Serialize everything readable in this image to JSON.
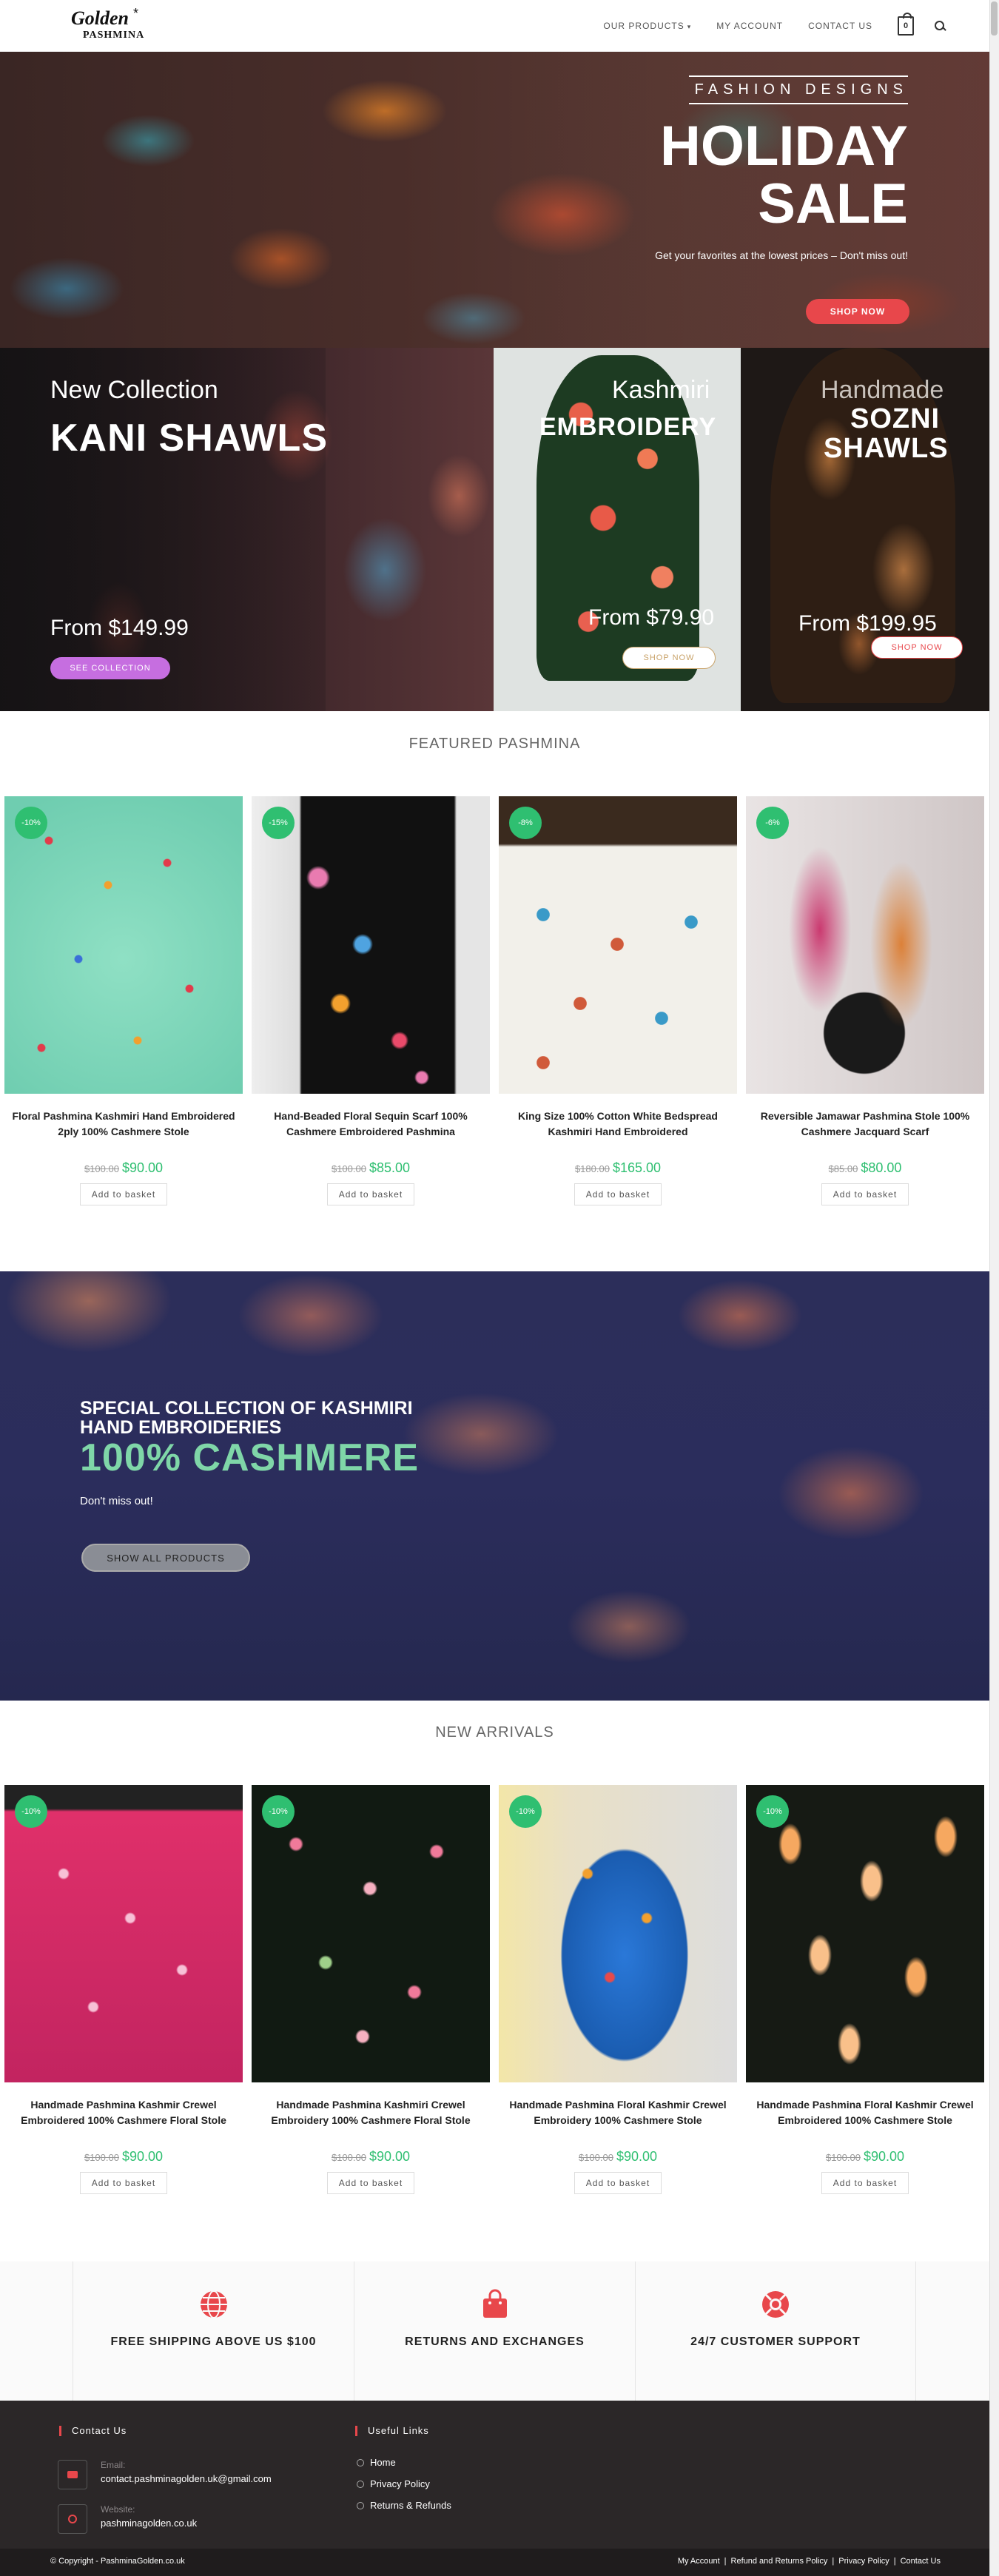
{
  "header": {
    "logo_top": "Golden",
    "logo_bottom": "PASHMINA",
    "nav": [
      "OUR PRODUCTS",
      "MY ACCOUNT",
      "CONTACT US"
    ],
    "cart_count": "0"
  },
  "hero": {
    "subtitle": "FASHION DESIGNS",
    "title_line1": "HOLIDAY",
    "title_line2": "SALE",
    "tagline": "Get your favorites at the lowest prices – Don't miss out!",
    "button": "SHOP NOW"
  },
  "promos": [
    {
      "line1": "New Collection",
      "line2": "KANI SHAWLS",
      "price": "From $149.99",
      "button": "SEE COLLECTION",
      "button_color": "#c66ee0"
    },
    {
      "line1": "Kashmiri",
      "line2": "EMBROIDERY",
      "price": "From $79.90",
      "button": "SHOP NOW"
    },
    {
      "line1": "Handmade",
      "line2": "SOZNI",
      "line3": "SHAWLS",
      "price": "From $199.95",
      "button": "SHOP NOW"
    }
  ],
  "featured": {
    "title": "FEATURED PASHMINA",
    "products": [
      {
        "badge": "-10%",
        "name": "Floral Pashmina Kashmiri Hand Embroidered 2ply 100% Cashmere Stole",
        "old_price": "$100.00",
        "price": "$90.00",
        "button": "Add to basket"
      },
      {
        "badge": "-15%",
        "name": "Hand-Beaded Floral Sequin Scarf 100% Cashmere Embroidered Pashmina",
        "old_price": "$100.00",
        "price": "$85.00",
        "button": "Add to basket"
      },
      {
        "badge": "-8%",
        "name": "King Size 100% Cotton White Bedspread Kashmiri Hand Embroidered",
        "old_price": "$180.00",
        "price": "$165.00",
        "button": "Add to basket"
      },
      {
        "badge": "-6%",
        "name": "Reversible Jamawar Pashmina Stole 100% Cashmere Jacquard Scarf",
        "old_price": "$85.00",
        "price": "$80.00",
        "button": "Add to basket"
      }
    ]
  },
  "banner": {
    "line1": "SPECIAL COLLECTION OF KASHMIRI HAND EMBROIDERIES",
    "line2": "100% CASHMERE",
    "line3": "Don't miss out!",
    "button": "SHOW ALL PRODUCTS"
  },
  "new_arrivals": {
    "title": "NEW ARRIVALS",
    "products": [
      {
        "badge": "-10%",
        "name": "Handmade Pashmina Kashmir Crewel Embroidered 100% Cashmere Floral Stole",
        "old_price": "$100.00",
        "price": "$90.00",
        "button": "Add to basket"
      },
      {
        "badge": "-10%",
        "name": "Handmade Pashmina Kashmiri Crewel Embroidery 100% Cashmere Floral Stole",
        "old_price": "$100.00",
        "price": "$90.00",
        "button": "Add to basket"
      },
      {
        "badge": "-10%",
        "name": "Handmade Pashmina Floral Kashmir Crewel Embroidery 100% Cashmere Stole",
        "old_price": "$100.00",
        "price": "$90.00",
        "button": "Add to basket"
      },
      {
        "badge": "-10%",
        "name": "Handmade Pashmina Floral Kashmir Crewel Embroidered 100% Cashmere Stole",
        "old_price": "$100.00",
        "price": "$90.00",
        "button": "Add to basket"
      }
    ]
  },
  "features": [
    {
      "icon": "globe-icon",
      "label": "FREE SHIPPING ABOVE US $100"
    },
    {
      "icon": "shopping-bag-icon",
      "label": "RETURNS AND EXCHANGES"
    },
    {
      "icon": "lifebuoy-icon",
      "label": "24/7 CUSTOMER SUPPORT"
    }
  ],
  "footer": {
    "contact_title": "Contact Us",
    "email_label": "Email:",
    "email": "contact.pashminagolden.uk@gmail.com",
    "website_label": "Website:",
    "website": "pashminagolden.co.uk",
    "links_title": "Useful Links",
    "links": [
      "Home",
      "Privacy Policy",
      "Returns & Refunds"
    ],
    "copyright": "© Copyright - PashminaGolden.co.uk",
    "bottom_links": [
      "My Account",
      "Refund and Returns Policy",
      "Privacy Policy",
      "Contact Us"
    ]
  },
  "colors": {
    "accent": "#e8474b",
    "sale_green": "#2fbf71",
    "cashmere_green": "#7fd6a8",
    "footer_bg": "#2b2728"
  }
}
